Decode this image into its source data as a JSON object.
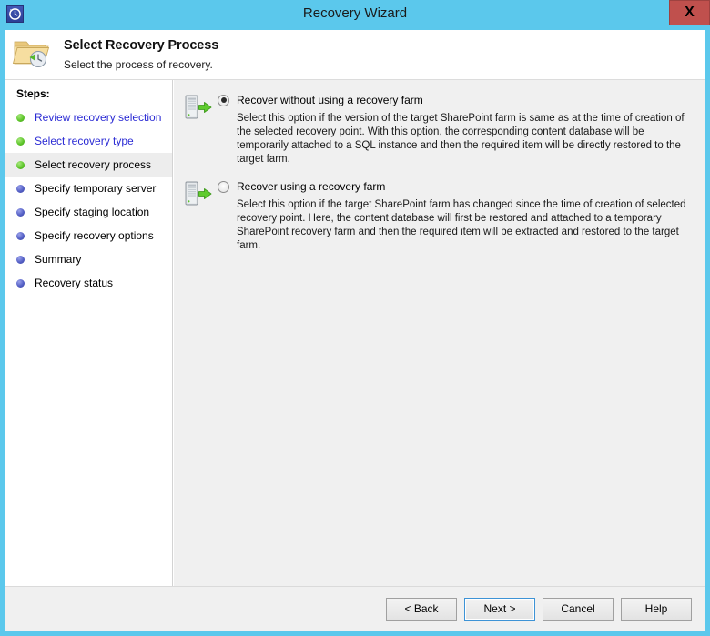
{
  "window": {
    "title": "Recovery Wizard",
    "app_icon": "restore-clock-icon",
    "close_label": "X"
  },
  "header": {
    "icon": "folder-restore-icon",
    "title": "Select Recovery Process",
    "subtitle": "Select the process of recovery."
  },
  "sidebar": {
    "title": "Steps:",
    "items": [
      {
        "label": "Review recovery selection",
        "bullet": "green",
        "state": "completed"
      },
      {
        "label": "Select recovery type",
        "bullet": "green",
        "state": "completed"
      },
      {
        "label": "Select recovery process",
        "bullet": "green",
        "state": "current"
      },
      {
        "label": "Specify temporary server",
        "bullet": "blue",
        "state": "pending"
      },
      {
        "label": "Specify staging location",
        "bullet": "blue",
        "state": "pending"
      },
      {
        "label": "Specify recovery options",
        "bullet": "blue",
        "state": "pending"
      },
      {
        "label": "Summary",
        "bullet": "blue",
        "state": "pending"
      },
      {
        "label": "Recovery status",
        "bullet": "blue",
        "state": "pending"
      }
    ]
  },
  "main": {
    "options": [
      {
        "icon": "server-restore-icon",
        "title": "Recover without using a recovery farm",
        "selected": true,
        "description": "Select this option if the version of the target SharePoint farm is same as at the time of creation of the selected recovery point. With this option, the corresponding content database will be temporarily attached to a SQL instance and then the required item will be directly restored to the target farm."
      },
      {
        "icon": "server-restore-icon",
        "title": "Recover using a recovery farm",
        "selected": false,
        "description": "Select this option if the target SharePoint farm has changed since the time of creation of selected recovery point. Here, the content database will first be restored and attached to a temporary SharePoint recovery farm and then the required item will be extracted and restored to the target farm."
      }
    ]
  },
  "footer": {
    "buttons": [
      {
        "label": "< Back",
        "default": false
      },
      {
        "label": "Next >",
        "default": true
      },
      {
        "label": "Cancel",
        "default": false
      },
      {
        "label": "Help",
        "default": false
      }
    ]
  },
  "colors": {
    "titlebar": "#5bc8ec",
    "close": "#c0504d",
    "link": "#2b2bd4",
    "content_bg": "#f0f0f0",
    "accent_focus": "#3d93d6"
  }
}
